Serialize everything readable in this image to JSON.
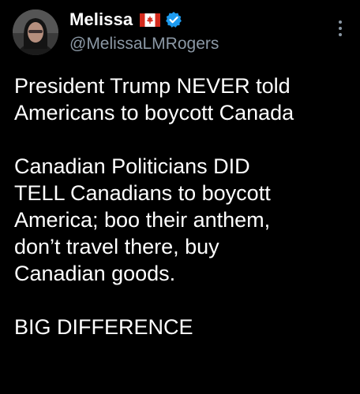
{
  "tweet": {
    "author": {
      "display_name": "Melissa",
      "flag_icon": "canada-flag-icon",
      "verified_icon": "verified-badge-icon",
      "handle": "@MelissaLMRogers"
    },
    "menu_icon": "more-options-icon",
    "paragraphs": [
      "President Trump NEVER told\nAmericans to boycott Canada",
      "Canadian Politicians DID\nTELL Canadians to boycott\nAmerica; boo their anthem,\ndon’t travel there, buy\nCanadian goods.",
      "BIG DIFFERENCE"
    ]
  },
  "colors": {
    "background": "#000000",
    "text": "#ffffff",
    "secondary_text": "#8b98a5",
    "verified_blue": "#1d9bf0",
    "flag_red": "#d52b1e"
  }
}
